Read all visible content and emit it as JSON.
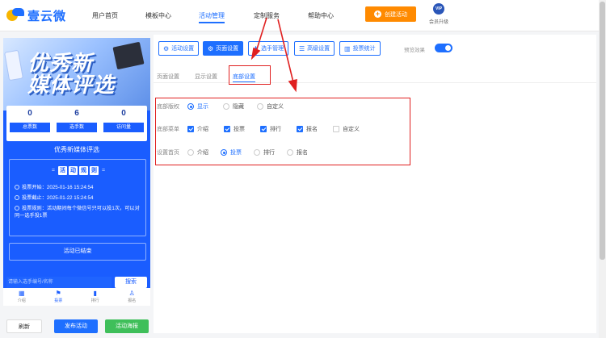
{
  "header": {
    "logo_text": "壹云微",
    "nav": [
      "用户首页",
      "模板中心",
      "活动管理",
      "定制服务",
      "帮助中心"
    ],
    "create_button": "创建活动",
    "vip_badge": "VIP",
    "vip_label": "会员升级"
  },
  "preview": {
    "banner_title_line1": "优秀新",
    "banner_title_line2": "媒体评选",
    "stats": [
      {
        "value": "0",
        "label": "总票数"
      },
      {
        "value": "6",
        "label": "选手数"
      },
      {
        "value": "0",
        "label": "访问量"
      }
    ],
    "activity_name": "优秀新媒体评选",
    "rules_title_chars": [
      "活",
      "动",
      "规",
      "则"
    ],
    "rules": [
      "投票开始：2025-01-16 15:24:54",
      "投票截止：2025-01-22 15:24:54",
      "投票规则：活动期间每个微信号只可以投1次，可以对同一选手投1票"
    ],
    "ended_text": "活动已结束",
    "search_placeholder": "请输入选手编号/名称",
    "search_button": "搜索",
    "tabbar": [
      {
        "icon": "home-icon",
        "label": "介绍"
      },
      {
        "icon": "flag-icon",
        "label": "投票"
      },
      {
        "icon": "bar-chart-icon",
        "label": "排行"
      },
      {
        "icon": "signup-icon",
        "label": "报名"
      }
    ]
  },
  "bottom_buttons": {
    "refresh": "刷新",
    "publish": "发布活动",
    "poster": "活动海报"
  },
  "panel": {
    "top_tabs": [
      {
        "label": "活动设置",
        "icon": "settings-icon"
      },
      {
        "label": "页面设置",
        "icon": "gear-icon"
      },
      {
        "label": "选手管理",
        "icon": "users-icon"
      },
      {
        "label": "高级设置",
        "icon": "sliders-icon"
      },
      {
        "label": "投票统计",
        "icon": "stats-icon"
      }
    ],
    "preview_toggle_label": "预览效果",
    "sub_tabs": [
      "页面设置",
      "显示设置",
      "底部设置"
    ],
    "form": {
      "row1": {
        "label": "底部版权",
        "options": [
          "显示",
          "隐藏",
          "自定义"
        ],
        "selected": "显示"
      },
      "row2": {
        "label": "底部菜单",
        "options": [
          "介绍",
          "投票",
          "排行",
          "报名",
          "自定义"
        ],
        "checked": [
          "介绍",
          "投票",
          "排行",
          "报名"
        ]
      },
      "row3": {
        "label": "设置首页",
        "options": [
          "介绍",
          "投票",
          "排行",
          "报名"
        ],
        "selected": "投票"
      }
    }
  },
  "colors": {
    "brand_blue": "#1e6fff",
    "orange": "#ff8a00",
    "green": "#3fbf5a",
    "highlight_red": "#e02020"
  }
}
